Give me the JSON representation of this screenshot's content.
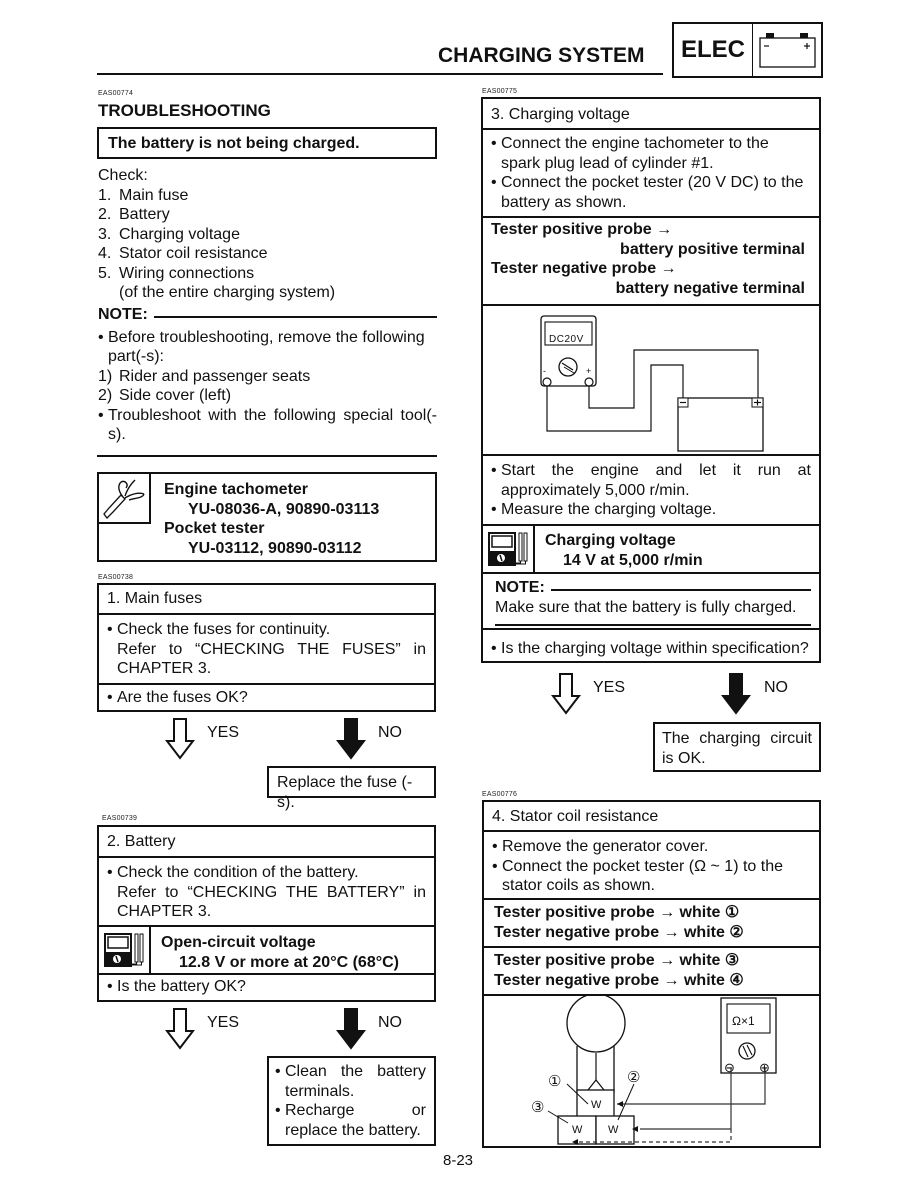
{
  "header": {
    "title": "CHARGING SYSTEM",
    "section_badge": "ELEC",
    "badge_icon": "battery-icon",
    "battery_minus": "−",
    "battery_plus": "+"
  },
  "left": {
    "code_troubleshooting": "EAS00774",
    "heading": "TROUBLESHOOTING",
    "problem": "The battery is not being charged.",
    "check_label": "Check:",
    "checks": [
      {
        "num": "1.",
        "text": "Main fuse"
      },
      {
        "num": "2.",
        "text": "Battery"
      },
      {
        "num": "3.",
        "text": "Charging voltage"
      },
      {
        "num": "4.",
        "text": "Stator coil resistance"
      },
      {
        "num": "5.",
        "text": "Wiring connections"
      }
    ],
    "check_5_sub": "(of the entire charging system)",
    "note": {
      "label": "NOTE:",
      "bullet1": "Before troubleshooting, remove the following part(-s):",
      "items": [
        {
          "num": "1)",
          "text": "Rider and passenger seats"
        },
        {
          "num": "2)",
          "text": "Side cover (left)"
        }
      ],
      "bullet2": "Troubleshoot with the following special tool(-s)."
    },
    "tools": {
      "icon": "special-tool-icon",
      "tool1_name": "Engine tachometer",
      "tool1_code": "YU-08036-A, 90890-03113",
      "tool2_name": "Pocket tester",
      "tool2_code": "YU-03112, 90890-03112"
    },
    "step1": {
      "code": "EAS00738",
      "title": "1. Main fuses",
      "line1": "Check the fuses for continuity.",
      "line2": "Refer to “CHECKING THE FUSES” in CHAPTER 3.",
      "question": "Are the fuses OK?",
      "yes": "YES",
      "no": "NO",
      "no_action": "Replace the fuse (-s)."
    },
    "step2": {
      "code": "EAS00739",
      "title": "2. Battery",
      "line1": "Check the condition of the battery.",
      "line2": "Refer to “CHECKING THE BATTERY” in CHAPTER 3.",
      "spec_icon": "multimeter-icon",
      "spec_name": "Open-circuit voltage",
      "spec_value": "12.8 V or more at 20°C (68°C)",
      "question": "Is the battery OK?",
      "yes": "YES",
      "no": "NO",
      "no_action1": "Clean the battery terminals.",
      "no_action2": "Recharge or replace the battery."
    }
  },
  "right": {
    "step3": {
      "code": "EAS00775",
      "title": "3. Charging voltage",
      "line1": "Connect the engine tachometer to the spark plug lead of cylinder #1.",
      "line2": "Connect the pocket tester (20 V DC) to the battery as shown.",
      "probe_pos_label": "Tester positive probe →",
      "probe_pos_target": "battery positive terminal",
      "probe_neg_label": "Tester negative probe →",
      "probe_neg_target": "battery negative terminal",
      "diagram": {
        "meter_display": "DC20V",
        "meter_minus": "-",
        "meter_plus": "+",
        "batt_minus": "−",
        "batt_plus": "+"
      },
      "line3": "Start the engine and let it run at approximately 5,000 r/min.",
      "line4": "Measure the charging voltage.",
      "spec_icon": "multimeter-icon",
      "spec_name": "Charging voltage",
      "spec_value": "14 V at 5,000 r/min",
      "note_label": "NOTE:",
      "note_text": "Make sure that the battery is fully charged.",
      "question": "Is the charging voltage within specification?",
      "yes": "YES",
      "no": "NO",
      "no_action": "The charging circuit is OK."
    },
    "step4": {
      "code": "EAS00776",
      "title": "4. Stator coil resistance",
      "line1": "Remove the generator cover.",
      "line2": "Connect the pocket tester (Ω ~ 1) to the stator coils as shown.",
      "pair1_pos": "Tester positive probe → white ①",
      "pair1_neg": "Tester negative probe → white ②",
      "pair2_pos": "Tester positive probe → white ③",
      "pair2_neg": "Tester negative probe → white ④",
      "diagram": {
        "meter_display": "Ω×1",
        "meter_minus": "⊖",
        "meter_plus": "⊕",
        "callout1": "①",
        "callout2": "②",
        "callout3": "③",
        "wire_label": "W"
      }
    }
  },
  "footer": {
    "page_number": "8-23"
  }
}
